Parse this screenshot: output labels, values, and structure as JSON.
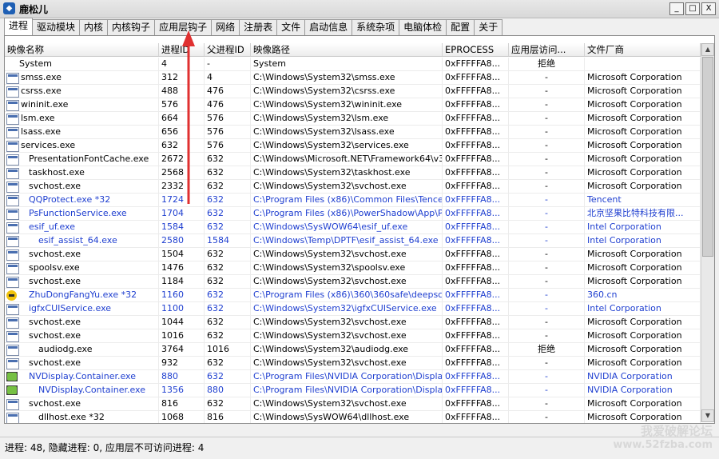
{
  "window": {
    "title": "鹿松儿",
    "icon": "app-logo-icon",
    "controls": [
      "_",
      "□",
      "X"
    ]
  },
  "tabs": [
    {
      "label": "进程",
      "active": true
    },
    {
      "label": "驱动模块"
    },
    {
      "label": "内核"
    },
    {
      "label": "内核钩子"
    },
    {
      "label": "应用层钩子"
    },
    {
      "label": "网络"
    },
    {
      "label": "注册表"
    },
    {
      "label": "文件"
    },
    {
      "label": "启动信息"
    },
    {
      "label": "系统杂项"
    },
    {
      "label": "电脑体检"
    },
    {
      "label": "配置"
    },
    {
      "label": "关于"
    }
  ],
  "columns": [
    "映像名称",
    "进程ID",
    "父进程ID",
    "映像路径",
    "EPROCESS",
    "应用层访问...",
    "文件厂商"
  ],
  "rows": [
    {
      "name": "System",
      "pid": "4",
      "ppid": "-",
      "path": "System",
      "ep": "0xFFFFFA8...",
      "access": "拒绝",
      "vendor": "",
      "icon": "none",
      "indent": 0,
      "color": "black"
    },
    {
      "name": "smss.exe",
      "pid": "312",
      "ppid": "4",
      "path": "C:\\Windows\\System32\\smss.exe",
      "ep": "0xFFFFFA8...",
      "access": "-",
      "vendor": "Microsoft Corporation",
      "icon": "app",
      "indent": 1,
      "color": "black"
    },
    {
      "name": "csrss.exe",
      "pid": "488",
      "ppid": "476",
      "path": "C:\\Windows\\System32\\csrss.exe",
      "ep": "0xFFFFFA8...",
      "access": "-",
      "vendor": "Microsoft Corporation",
      "icon": "app",
      "indent": 0,
      "color": "black"
    },
    {
      "name": "wininit.exe",
      "pid": "576",
      "ppid": "476",
      "path": "C:\\Windows\\System32\\wininit.exe",
      "ep": "0xFFFFFA8...",
      "access": "-",
      "vendor": "Microsoft Corporation",
      "icon": "app",
      "indent": 0,
      "color": "black"
    },
    {
      "name": "lsm.exe",
      "pid": "664",
      "ppid": "576",
      "path": "C:\\Windows\\System32\\lsm.exe",
      "ep": "0xFFFFFA8...",
      "access": "-",
      "vendor": "Microsoft Corporation",
      "icon": "app",
      "indent": 1,
      "color": "black"
    },
    {
      "name": "lsass.exe",
      "pid": "656",
      "ppid": "576",
      "path": "C:\\Windows\\System32\\lsass.exe",
      "ep": "0xFFFFFA8...",
      "access": "-",
      "vendor": "Microsoft Corporation",
      "icon": "app",
      "indent": 1,
      "color": "black"
    },
    {
      "name": "services.exe",
      "pid": "632",
      "ppid": "576",
      "path": "C:\\Windows\\System32\\services.exe",
      "ep": "0xFFFFFA8...",
      "access": "-",
      "vendor": "Microsoft Corporation",
      "icon": "app",
      "indent": 1,
      "color": "black"
    },
    {
      "name": "PresentationFontCache.exe",
      "pid": "2672",
      "ppid": "632",
      "path": "C:\\Windows\\Microsoft.NET\\Framework64\\v3...",
      "ep": "0xFFFFFA8...",
      "access": "-",
      "vendor": "Microsoft Corporation",
      "icon": "app",
      "indent": 2,
      "color": "black"
    },
    {
      "name": "taskhost.exe",
      "pid": "2568",
      "ppid": "632",
      "path": "C:\\Windows\\System32\\taskhost.exe",
      "ep": "0xFFFFFA8...",
      "access": "-",
      "vendor": "Microsoft Corporation",
      "icon": "app",
      "indent": 2,
      "color": "black"
    },
    {
      "name": "svchost.exe",
      "pid": "2332",
      "ppid": "632",
      "path": "C:\\Windows\\System32\\svchost.exe",
      "ep": "0xFFFFFA8...",
      "access": "-",
      "vendor": "Microsoft Corporation",
      "icon": "app",
      "indent": 2,
      "color": "black"
    },
    {
      "name": "QQProtect.exe *32",
      "pid": "1724",
      "ppid": "632",
      "path": "C:\\Program Files (x86)\\Common Files\\Tence...",
      "ep": "0xFFFFFA8...",
      "access": "-",
      "vendor": "Tencent",
      "icon": "app",
      "indent": 2,
      "color": "blue"
    },
    {
      "name": "PsFunctionService.exe",
      "pid": "1704",
      "ppid": "632",
      "path": "C:\\Program Files (x86)\\PowerShadow\\App\\P...",
      "ep": "0xFFFFFA8...",
      "access": "-",
      "vendor": "北京坚果比特科技有限...",
      "icon": "app",
      "indent": 2,
      "color": "blue"
    },
    {
      "name": "esif_uf.exe",
      "pid": "1584",
      "ppid": "632",
      "path": "C:\\Windows\\SysWOW64\\esif_uf.exe",
      "ep": "0xFFFFFA8...",
      "access": "-",
      "vendor": "Intel Corporation",
      "icon": "app",
      "indent": 2,
      "color": "blue"
    },
    {
      "name": "esif_assist_64.exe",
      "pid": "2580",
      "ppid": "1584",
      "path": "C:\\Windows\\Temp\\DPTF\\esif_assist_64.exe",
      "ep": "0xFFFFFA8...",
      "access": "-",
      "vendor": "Intel Corporation",
      "icon": "app",
      "indent": 3,
      "color": "blue"
    },
    {
      "name": "svchost.exe",
      "pid": "1504",
      "ppid": "632",
      "path": "C:\\Windows\\System32\\svchost.exe",
      "ep": "0xFFFFFA8...",
      "access": "-",
      "vendor": "Microsoft Corporation",
      "icon": "app",
      "indent": 2,
      "color": "black"
    },
    {
      "name": "spoolsv.exe",
      "pid": "1476",
      "ppid": "632",
      "path": "C:\\Windows\\System32\\spoolsv.exe",
      "ep": "0xFFFFFA8...",
      "access": "-",
      "vendor": "Microsoft Corporation",
      "icon": "app",
      "indent": 2,
      "color": "black"
    },
    {
      "name": "svchost.exe",
      "pid": "1184",
      "ppid": "632",
      "path": "C:\\Windows\\System32\\svchost.exe",
      "ep": "0xFFFFFA8...",
      "access": "-",
      "vendor": "Microsoft Corporation",
      "icon": "app",
      "indent": 2,
      "color": "black"
    },
    {
      "name": "ZhuDongFangYu.exe *32",
      "pid": "1160",
      "ppid": "632",
      "path": "C:\\Program Files (x86)\\360\\360safe\\deepsc...",
      "ep": "0xFFFFFA8...",
      "access": "-",
      "vendor": "360.cn",
      "icon": "coin",
      "indent": 2,
      "color": "blue"
    },
    {
      "name": "igfxCUIService.exe",
      "pid": "1100",
      "ppid": "632",
      "path": "C:\\Windows\\System32\\igfxCUIService.exe",
      "ep": "0xFFFFFA8...",
      "access": "-",
      "vendor": "Intel Corporation",
      "icon": "app",
      "indent": 2,
      "color": "blue"
    },
    {
      "name": "svchost.exe",
      "pid": "1044",
      "ppid": "632",
      "path": "C:\\Windows\\System32\\svchost.exe",
      "ep": "0xFFFFFA8...",
      "access": "-",
      "vendor": "Microsoft Corporation",
      "icon": "app",
      "indent": 2,
      "color": "black"
    },
    {
      "name": "svchost.exe",
      "pid": "1016",
      "ppid": "632",
      "path": "C:\\Windows\\System32\\svchost.exe",
      "ep": "0xFFFFFA8...",
      "access": "-",
      "vendor": "Microsoft Corporation",
      "icon": "app",
      "indent": 2,
      "color": "black"
    },
    {
      "name": "audiodg.exe",
      "pid": "3764",
      "ppid": "1016",
      "path": "C:\\Windows\\System32\\audiodg.exe",
      "ep": "0xFFFFFA8...",
      "access": "拒绝",
      "vendor": "Microsoft Corporation",
      "icon": "app",
      "indent": 3,
      "color": "black"
    },
    {
      "name": "svchost.exe",
      "pid": "932",
      "ppid": "632",
      "path": "C:\\Windows\\System32\\svchost.exe",
      "ep": "0xFFFFFA8...",
      "access": "-",
      "vendor": "Microsoft Corporation",
      "icon": "app",
      "indent": 2,
      "color": "black"
    },
    {
      "name": "NVDisplay.Container.exe",
      "pid": "880",
      "ppid": "632",
      "path": "C:\\Program Files\\NVIDIA Corporation\\Displa...",
      "ep": "0xFFFFFA8...",
      "access": "-",
      "vendor": "NVIDIA Corporation",
      "icon": "shield",
      "indent": 2,
      "color": "blue"
    },
    {
      "name": "NVDisplay.Container.exe",
      "pid": "1356",
      "ppid": "880",
      "path": "C:\\Program Files\\NVIDIA Corporation\\Displa...",
      "ep": "0xFFFFFA8...",
      "access": "-",
      "vendor": "NVIDIA Corporation",
      "icon": "shield",
      "indent": 3,
      "color": "blue"
    },
    {
      "name": "svchost.exe",
      "pid": "816",
      "ppid": "632",
      "path": "C:\\Windows\\System32\\svchost.exe",
      "ep": "0xFFFFFA8...",
      "access": "-",
      "vendor": "Microsoft Corporation",
      "icon": "app",
      "indent": 2,
      "color": "black"
    },
    {
      "name": "dllhost.exe *32",
      "pid": "1068",
      "ppid": "816",
      "path": "C:\\Windows\\SysWOW64\\dllhost.exe",
      "ep": "0xFFFFFA8...",
      "access": "-",
      "vendor": "Microsoft Corporation",
      "icon": "app",
      "indent": 3,
      "color": "black"
    }
  ],
  "status": {
    "text": "进程: 48, 隐藏进程: 0, 应用层不可访问进程: 4"
  },
  "watermark": {
    "line1": "我爱破解论坛",
    "url": "www.52fzba.com"
  },
  "colors": {
    "blue_text": "#1f3fd0",
    "annotation_arrow": "#e03030"
  }
}
